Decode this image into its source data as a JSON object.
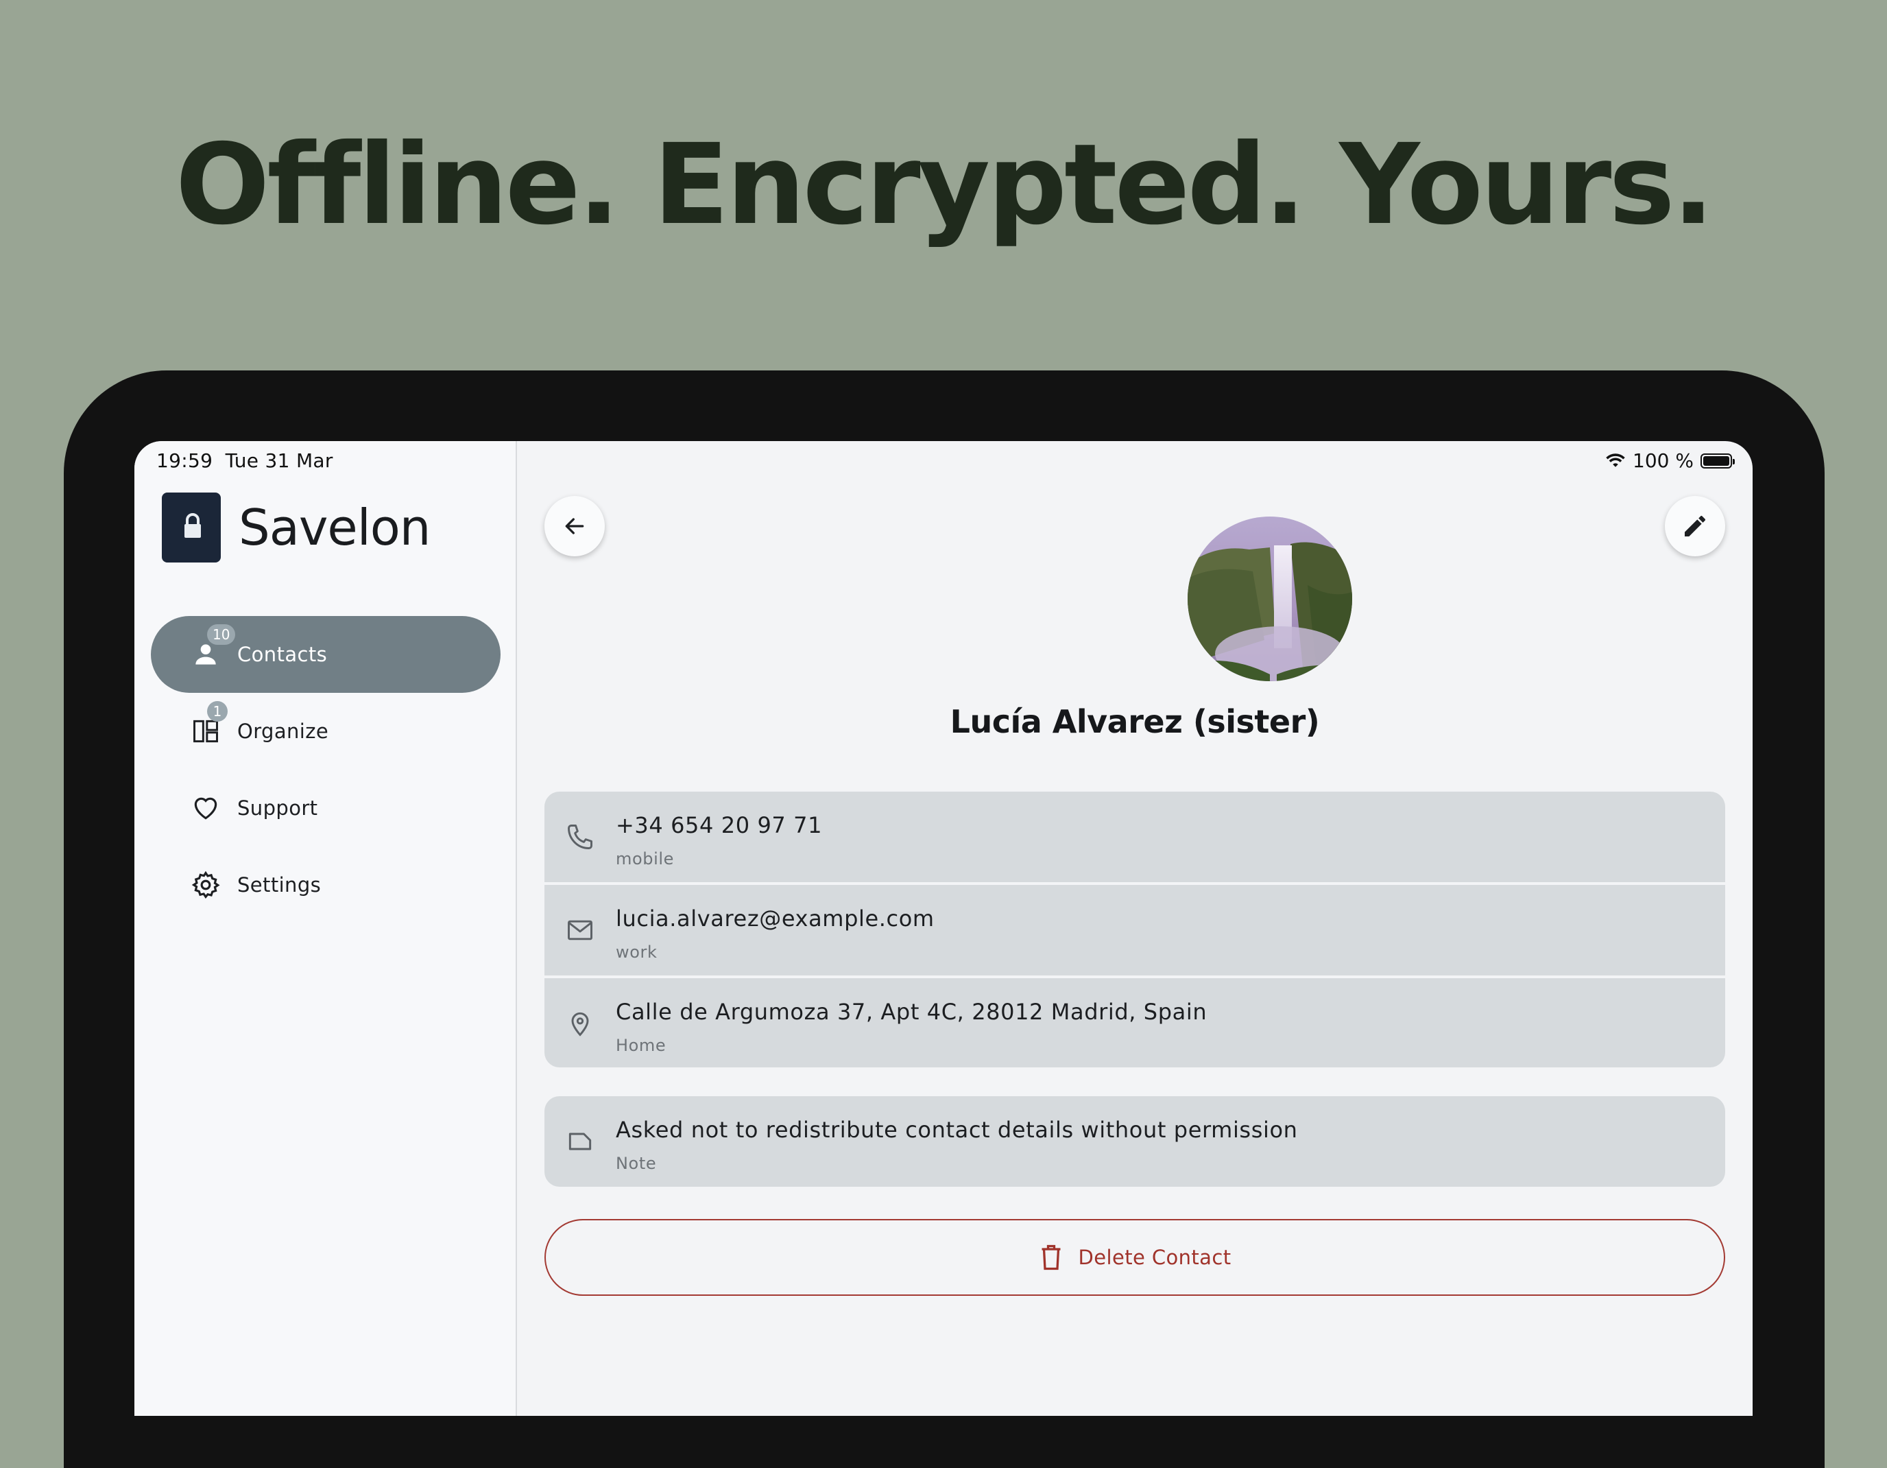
{
  "headline": "Offline. Encrypted. Yours.",
  "status_bar": {
    "time": "19:59",
    "date": "Tue 31 Mar",
    "battery": "100 %"
  },
  "sidebar": {
    "app_name": "Savelon",
    "items": [
      {
        "label": "Contacts",
        "icon": "person-icon",
        "badge": "10",
        "active": true
      },
      {
        "label": "Organize",
        "icon": "dashboard-icon",
        "badge": "1",
        "active": false
      },
      {
        "label": "Support",
        "icon": "heart-icon",
        "badge": null,
        "active": false
      },
      {
        "label": "Settings",
        "icon": "gear-icon",
        "badge": null,
        "active": false
      }
    ]
  },
  "contact": {
    "name": "Lucía Alvarez (sister)",
    "phone": {
      "value": "+34 654 20 97 71",
      "label": "mobile"
    },
    "email": {
      "value": "lucia.alvarez@example.com",
      "label": "work"
    },
    "address": {
      "value": "Calle de Argumoza 37, Apt 4C, 28012 Madrid, Spain",
      "label": "Home"
    },
    "note": {
      "value": "Asked not to redistribute contact details without permission",
      "label": "Note"
    }
  },
  "actions": {
    "delete_label": "Delete Contact"
  },
  "colors": {
    "background": "#99a594",
    "headline": "#1f2a1c",
    "nav_active": "#717f86",
    "card": "#d6dadd",
    "danger": "#a33a33"
  }
}
